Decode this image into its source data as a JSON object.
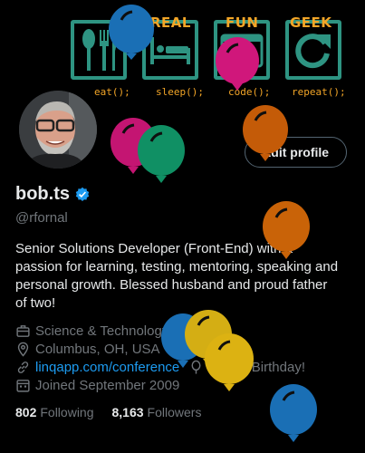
{
  "banner": {
    "tiles": [
      {
        "title": "",
        "caption": "eat();",
        "icon": "fork-knife-icon"
      },
      {
        "title": "REAL",
        "caption": "sleep();",
        "icon": "bed-icon"
      },
      {
        "title": "FUN",
        "caption": "code();",
        "icon": "code-icon"
      },
      {
        "title": "GEEK",
        "caption": "repeat();",
        "icon": "repeat-icon"
      }
    ],
    "accent_color": "#2e9482",
    "text_color": "#f2a527"
  },
  "profile": {
    "display_name": "bob.ts",
    "handle": "@rfornal",
    "edit_button": "Edit profile",
    "bio": "Senior Solutions Developer (Front-End) with a passion for learning, testing, mentoring, speaking and personal growth. Blessed husband and proud father of two!",
    "category": "Science & Technology",
    "location": "Columbus, OH, USA",
    "link": "linqapp.com/conference",
    "birthday": "Happy Birthday!",
    "joined": "Joined September 2009",
    "following_count": "802",
    "following_label": "Following",
    "followers_count": "8,163",
    "followers_label": "Followers"
  },
  "colors": {
    "background": "#000000",
    "link": "#1d9bf0",
    "muted": "#71767b",
    "verified": "#1d9bf0"
  }
}
